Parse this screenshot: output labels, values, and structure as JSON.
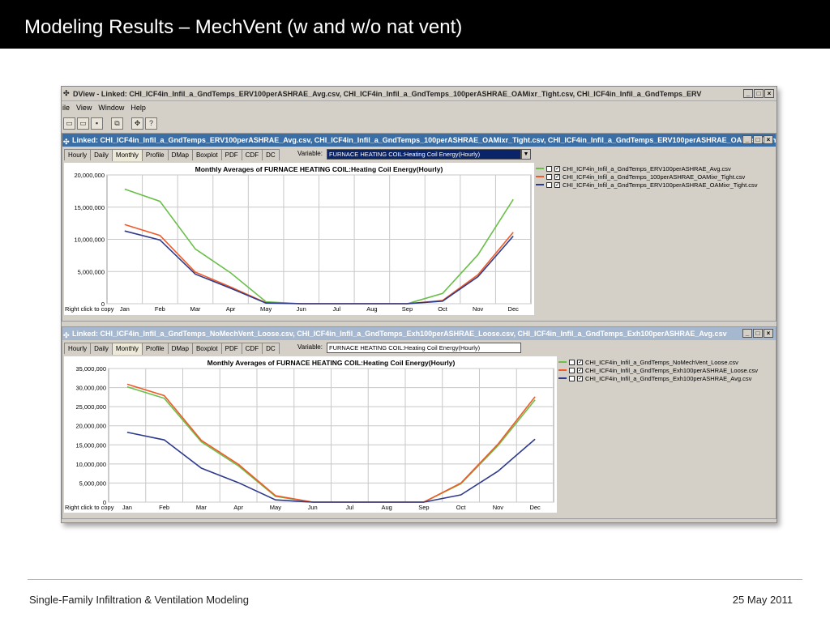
{
  "slide": {
    "title": "Modeling Results – MechVent (w and w/o nat vent)",
    "footer_left": "Single-Family Infiltration & Ventilation Modeling",
    "footer_right": "25 May 2011"
  },
  "app": {
    "title": "DView - Linked: CHI_ICF4in_Infil_a_GndTemps_ERV100perASHRAE_Avg.csv, CHI_ICF4in_Infil_a_GndTemps_100perASHRAE_OAMixr_Tight.csv, CHI_ICF4in_Infil_a_GndTemps_ERV",
    "menu": [
      "ile",
      "View",
      "Window",
      "Help"
    ],
    "window_buttons": [
      "_",
      "□",
      "×"
    ]
  },
  "window1": {
    "title": "Linked: CHI_ICF4in_Infil_a_GndTemps_ERV100perASHRAE_Avg.csv, CHI_ICF4in_Infil_a_GndTemps_100perASHRAE_OAMixr_Tight.csv, CHI_ICF4in_Infil_a_GndTemps_ERV100perASHRAE_OAMixr_Tigh...",
    "tabs": [
      "Hourly",
      "Daily",
      "Monthly",
      "Profile",
      "DMap",
      "Boxplot",
      "PDF",
      "CDF",
      "DC"
    ],
    "active_tab": "Monthly",
    "variable_label": "Variable:",
    "variable_value": "FURNACE HEATING COIL:Heating Coil Energy(Hourly)",
    "copy_hint": "Right click to copy"
  },
  "window2": {
    "title": "Linked: CHI_ICF4in_Infil_a_GndTemps_NoMechVent_Loose.csv, CHI_ICF4in_Infil_a_GndTemps_Exh100perASHRAE_Loose.csv, CHI_ICF4in_Infil_a_GndTemps_Exh100perASHRAE_Avg.csv",
    "tabs": [
      "Hourly",
      "Daily",
      "Monthly",
      "Profile",
      "DMap",
      "Boxplot",
      "PDF",
      "CDF",
      "DC"
    ],
    "active_tab": "Monthly",
    "variable_label": "Variable:",
    "variable_value": "FURNACE HEATING COIL:Heating Coil Energy(Hourly)",
    "copy_hint": "Right click to copy"
  },
  "chart_data": [
    {
      "type": "line",
      "title": "Monthly Averages of FURNACE HEATING COIL:Heating Coil Energy(Hourly)",
      "categories": [
        "Jan",
        "Feb",
        "Mar",
        "Apr",
        "May",
        "Jun",
        "Jul",
        "Aug",
        "Sep",
        "Oct",
        "Nov",
        "Dec"
      ],
      "ylim": [
        0,
        20000000
      ],
      "yticks": [
        "20,000,000",
        "15,000,000",
        "10,000,000",
        "5,000,000",
        "0"
      ],
      "ytick_values": [
        20000000,
        15000000,
        10000000,
        5000000,
        0
      ],
      "grid": true,
      "legend_position": "right",
      "series": [
        {
          "name": "CHI_ICF4in_Infil_a_GndTemps_ERV100perASHRAE_Avg.csv",
          "color": "#6abf4b",
          "checked": false,
          "values": [
            17800000,
            15900000,
            8500000,
            4800000,
            300000,
            0,
            0,
            0,
            0,
            1600000,
            7600000,
            16200000
          ]
        },
        {
          "name": "CHI_ICF4in_Infil_a_GndTemps_100perASHRAE_OAMixr_Tight.csv",
          "color": "#f05a28",
          "checked": true,
          "values": [
            12300000,
            10600000,
            4900000,
            2600000,
            150000,
            0,
            0,
            0,
            0,
            500000,
            4500000,
            11100000
          ]
        },
        {
          "name": "CHI_ICF4in_Infil_a_GndTemps_ERV100perASHRAE_OAMixr_Tight.csv",
          "color": "#2e3a8c",
          "checked": true,
          "values": [
            11300000,
            9900000,
            4600000,
            2400000,
            100000,
            0,
            0,
            0,
            0,
            400000,
            4200000,
            10500000
          ]
        }
      ]
    },
    {
      "type": "line",
      "title": "Monthly Averages of FURNACE HEATING COIL:Heating Coil Energy(Hourly)",
      "categories": [
        "Jan",
        "Feb",
        "Mar",
        "Apr",
        "May",
        "Jun",
        "Jul",
        "Aug",
        "Sep",
        "Oct",
        "Nov",
        "Dec"
      ],
      "ylim": [
        0,
        35000000
      ],
      "yticks": [
        "35,000,000",
        "30,000,000",
        "25,000,000",
        "20,000,000",
        "15,000,000",
        "10,000,000",
        "5,000,000",
        "0"
      ],
      "ytick_values": [
        35000000,
        30000000,
        25000000,
        20000000,
        15000000,
        10000000,
        5000000,
        0
      ],
      "grid": true,
      "legend_position": "right",
      "series": [
        {
          "name": "CHI_ICF4in_Infil_a_GndTemps_NoMechVent_Loose.csv",
          "color": "#6abf4b",
          "checked": false,
          "values": [
            30200000,
            27200000,
            15800000,
            9500000,
            1500000,
            0,
            0,
            0,
            0,
            4800000,
            14800000,
            26800000
          ]
        },
        {
          "name": "CHI_ICF4in_Infil_a_GndTemps_Exh100perASHRAE_Loose.csv",
          "color": "#f05a28",
          "checked": true,
          "values": [
            30900000,
            27900000,
            16200000,
            9900000,
            1700000,
            0,
            0,
            0,
            0,
            5000000,
            15200000,
            27600000
          ]
        },
        {
          "name": "CHI_ICF4in_Infil_a_GndTemps_Exh100perASHRAE_Avg.csv",
          "color": "#2e3a8c",
          "checked": true,
          "values": [
            18300000,
            16300000,
            8900000,
            5100000,
            600000,
            0,
            0,
            0,
            0,
            1900000,
            8100000,
            16500000
          ]
        }
      ]
    }
  ]
}
